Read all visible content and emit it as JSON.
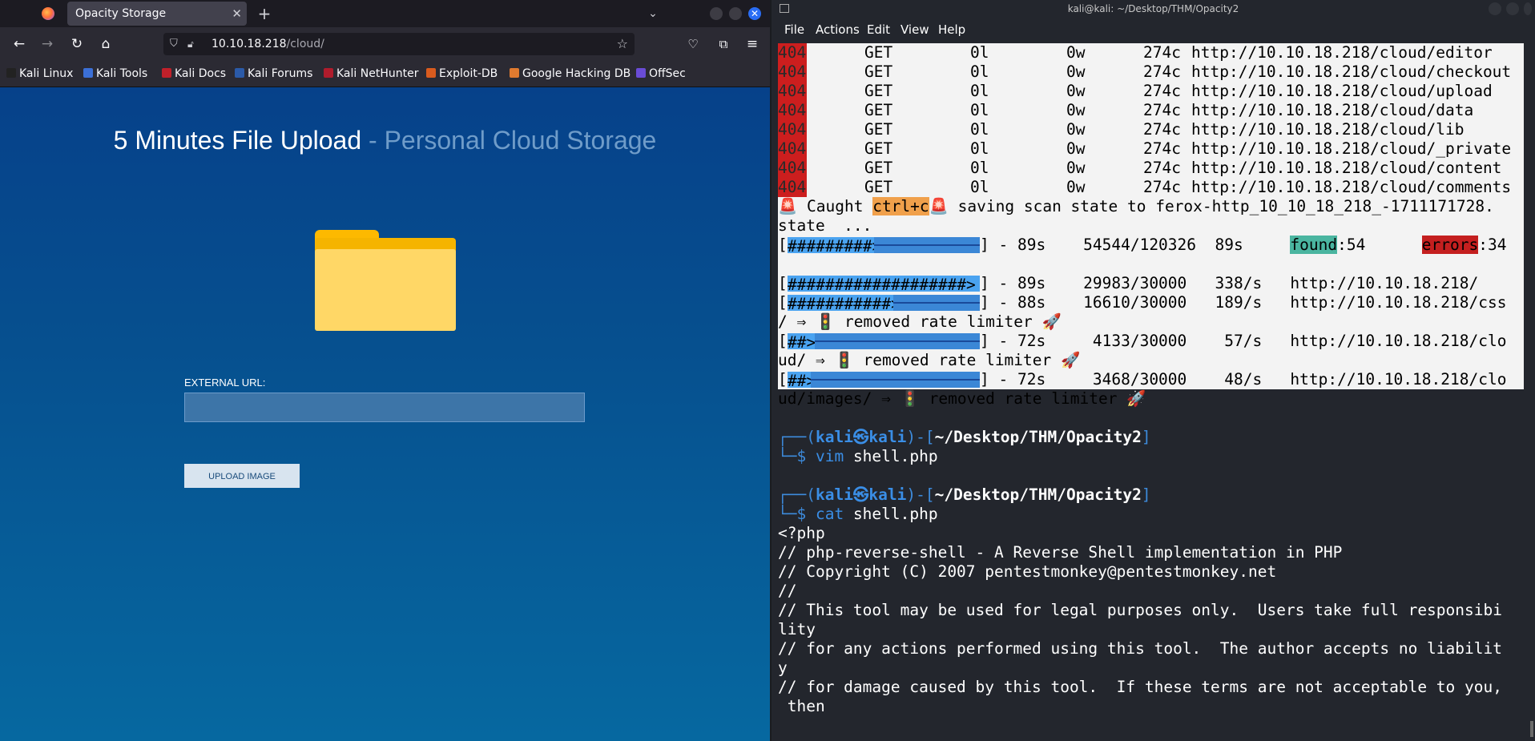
{
  "browser": {
    "tab_title": "Opacity Storage",
    "tab_close": "✕",
    "new_tab": "+",
    "tab_list": "⌄",
    "win_close": "✕",
    "url_host": "10.10.18.218",
    "url_path": "/cloud/",
    "bookmarks": [
      "Kali Linux",
      "Kali Tools",
      "Kali Docs",
      "Kali Forums",
      "Kali NetHunter",
      "Exploit-DB",
      "Google Hacking DB",
      "OffSec"
    ],
    "bookmark_colors": [
      "#222222",
      "#3b6fd6",
      "#c0202a",
      "#2b5aa8",
      "#b01c2c",
      "#d95b1e",
      "#e07a2f",
      "#6a4cd6"
    ],
    "page": {
      "heading_main": "5 Minutes File Upload",
      "heading_sub": " - Personal Cloud Storage",
      "external_url_label": "EXTERNAL URL:",
      "external_url_value": "",
      "upload_button": "UPLOAD IMAGE"
    }
  },
  "terminal": {
    "title": "kali@kali: ~/Desktop/THM/Opacity2",
    "menu": [
      "File",
      "Actions",
      "Edit",
      "View",
      "Help"
    ],
    "scan_rows": [
      {
        "status": "404",
        "method": "GET",
        "lines": "0l",
        "words": "0w",
        "chars": "274c",
        "url": "http://10.10.18.218/cloud/editor"
      },
      {
        "status": "404",
        "method": "GET",
        "lines": "0l",
        "words": "0w",
        "chars": "274c",
        "url": "http://10.10.18.218/cloud/checkout"
      },
      {
        "status": "404",
        "method": "GET",
        "lines": "0l",
        "words": "0w",
        "chars": "274c",
        "url": "http://10.10.18.218/cloud/upload"
      },
      {
        "status": "404",
        "method": "GET",
        "lines": "0l",
        "words": "0w",
        "chars": "274c",
        "url": "http://10.10.18.218/cloud/data"
      },
      {
        "status": "404",
        "method": "GET",
        "lines": "0l",
        "words": "0w",
        "chars": "274c",
        "url": "http://10.10.18.218/cloud/lib"
      },
      {
        "status": "404",
        "method": "GET",
        "lines": "0l",
        "words": "0w",
        "chars": "274c",
        "url": "http://10.10.18.218/cloud/_private"
      },
      {
        "status": "404",
        "method": "GET",
        "lines": "0l",
        "words": "0w",
        "chars": "274c",
        "url": "http://10.10.18.218/cloud/content"
      },
      {
        "status": "404",
        "method": "GET",
        "lines": "0l",
        "words": "0w",
        "chars": "274c",
        "url": "http://10.10.18.218/cloud/comments"
      }
    ],
    "caught": {
      "icon": "🚨",
      "pre": " Caught ",
      "key": "ctrl+c",
      "post": " saving scan state to ferox-http_10_10_18_218_-1711171728.",
      "cont": "state  ..."
    },
    "overall": {
      "fill": "#########>",
      "stats": "] - 89s    54544/120326  89s     ",
      "found_label": "found",
      "found_val": ":54      ",
      "errors_label": "errors",
      "errors_val": ":34"
    },
    "progress": [
      {
        "fill": "###################>",
        "stats": "] - 89s    29983/30000   338/s   http://10.10.18.218/",
        "cont": ""
      },
      {
        "fill": "###########>",
        "stats": "] - 88s    16610/30000   189/s   http://10.10.18.218/css",
        "cont": "/ ⇒ 🚦 removed rate limiter 🚀"
      },
      {
        "fill": "##>",
        "stats": "] - 72s     4133/30000    57/s   http://10.10.18.218/clo",
        "cont": "ud/ ⇒ 🚦 removed rate limiter 🚀"
      },
      {
        "fill": "##>",
        "stats": "] - 72s     3468/30000    48/s   http://10.10.18.218/clo",
        "cont": "ud/images/ ⇒ 🚦 removed rate limiter 🚀"
      }
    ],
    "progress_fractions": [
      1.0,
      0.55,
      0.14,
      0.12
    ],
    "overall_fraction": 0.45,
    "prompts": [
      {
        "top": "┌──(",
        "user": "kali㉿kali",
        "mid": ")-[",
        "path": "~/Desktop/THM/Opacity2",
        "end": "]",
        "dollar": "└─$ ",
        "cmd": "vim",
        "arg": " shell.php"
      },
      {
        "top": "┌──(",
        "user": "kali㉿kali",
        "mid": ")-[",
        "path": "~/Desktop/THM/Opacity2",
        "end": "]",
        "dollar": "└─$ ",
        "cmd": "cat",
        "arg": " shell.php"
      }
    ],
    "file_lines": [
      "<?php",
      "// php-reverse-shell - A Reverse Shell implementation in PHP",
      "// Copyright (C) 2007 pentestmonkey@pentestmonkey.net",
      "//",
      "// This tool may be used for legal purposes only.  Users take full responsibi",
      "lity",
      "// for any actions performed using this tool.  The author accepts no liabilit",
      "y",
      "// for damage caused by this tool.  If these terms are not acceptable to you,",
      " then"
    ]
  }
}
